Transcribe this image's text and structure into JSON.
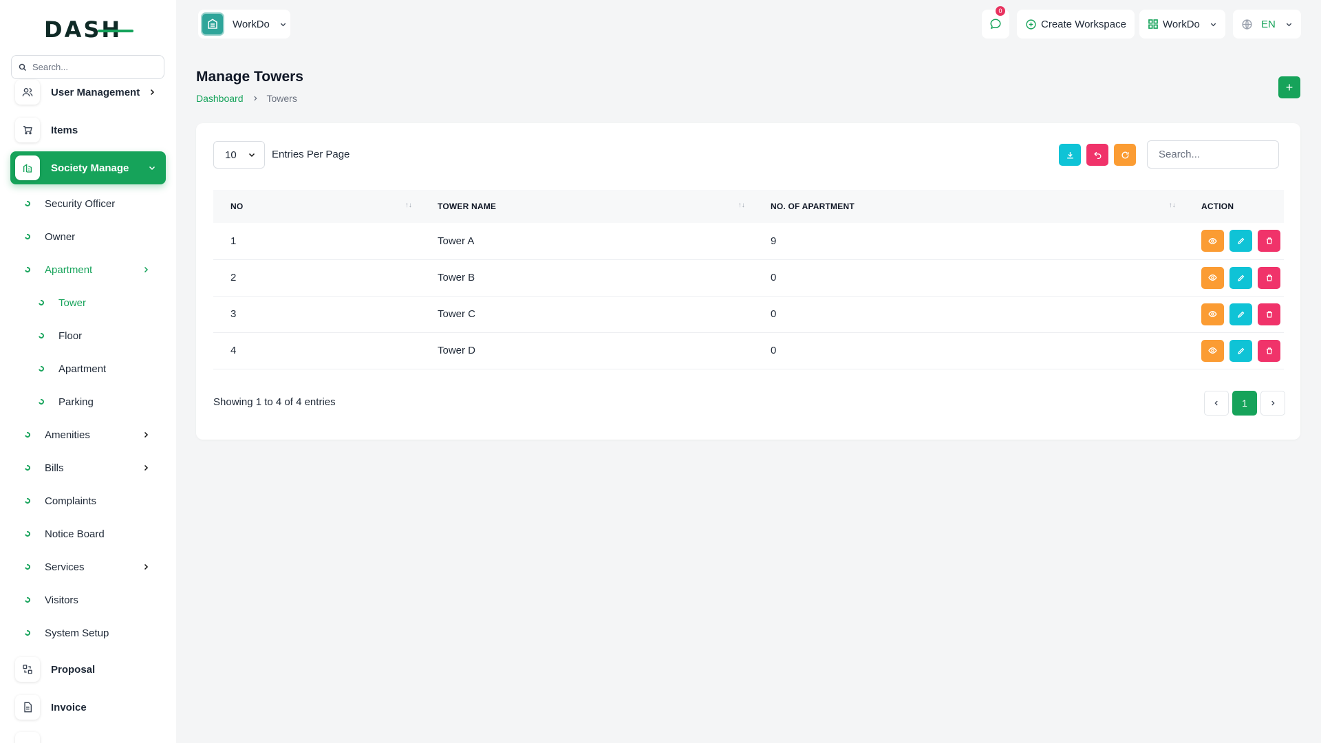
{
  "brand": {
    "logo_text": "DASH"
  },
  "sidebar": {
    "search_placeholder": "Search...",
    "top_items": [
      {
        "label": "User Management",
        "icon": "users-icon",
        "has_children": true
      },
      {
        "label": "Items",
        "icon": "cart-icon",
        "has_children": false
      },
      {
        "label": "Society Manage",
        "icon": "building-icon",
        "has_children": true,
        "active": true
      }
    ],
    "sub_items": [
      {
        "label": "Security Officer"
      },
      {
        "label": "Owner"
      },
      {
        "label": "Apartment",
        "active": true,
        "has_children": true
      },
      {
        "label": "Tower",
        "active": true
      },
      {
        "label": "Floor"
      },
      {
        "label": "Apartment"
      },
      {
        "label": "Parking"
      },
      {
        "label": "Amenities",
        "has_children": true
      },
      {
        "label": "Bills",
        "has_children": true
      },
      {
        "label": "Complaints"
      },
      {
        "label": "Notice Board"
      },
      {
        "label": "Services",
        "has_children": true
      },
      {
        "label": "Visitors"
      },
      {
        "label": "System Setup"
      }
    ],
    "bottom_items": [
      {
        "label": "Proposal",
        "icon": "proposal-icon"
      },
      {
        "label": "Invoice",
        "icon": "invoice-icon"
      }
    ]
  },
  "header": {
    "workspace_name": "WorkDo",
    "notification_count": "0",
    "create_workspace_label": "Create Workspace",
    "workspace_menu_label": "WorkDo",
    "language": "EN"
  },
  "page": {
    "title": "Manage Towers",
    "breadcrumb": [
      "Dashboard",
      "Towers"
    ],
    "add_label": "+"
  },
  "table": {
    "entries_per_page": "10",
    "entries_label": "Entries Per Page",
    "search_placeholder": "Search...",
    "columns": [
      "NO",
      "TOWER NAME",
      "NO. OF APARTMENT",
      "ACTION"
    ],
    "rows": [
      {
        "no": "1",
        "name": "Tower A",
        "apartments": "9"
      },
      {
        "no": "2",
        "name": "Tower B",
        "apartments": "0"
      },
      {
        "no": "3",
        "name": "Tower C",
        "apartments": "0"
      },
      {
        "no": "4",
        "name": "Tower D",
        "apartments": "0"
      }
    ],
    "showing": "Showing 1 to 4 of 4 entries",
    "current_page": "1"
  },
  "colors": {
    "primary": "#16a35a",
    "cyan": "#0fc3d6",
    "pink": "#f0336a",
    "orange": "#fb9c33"
  }
}
